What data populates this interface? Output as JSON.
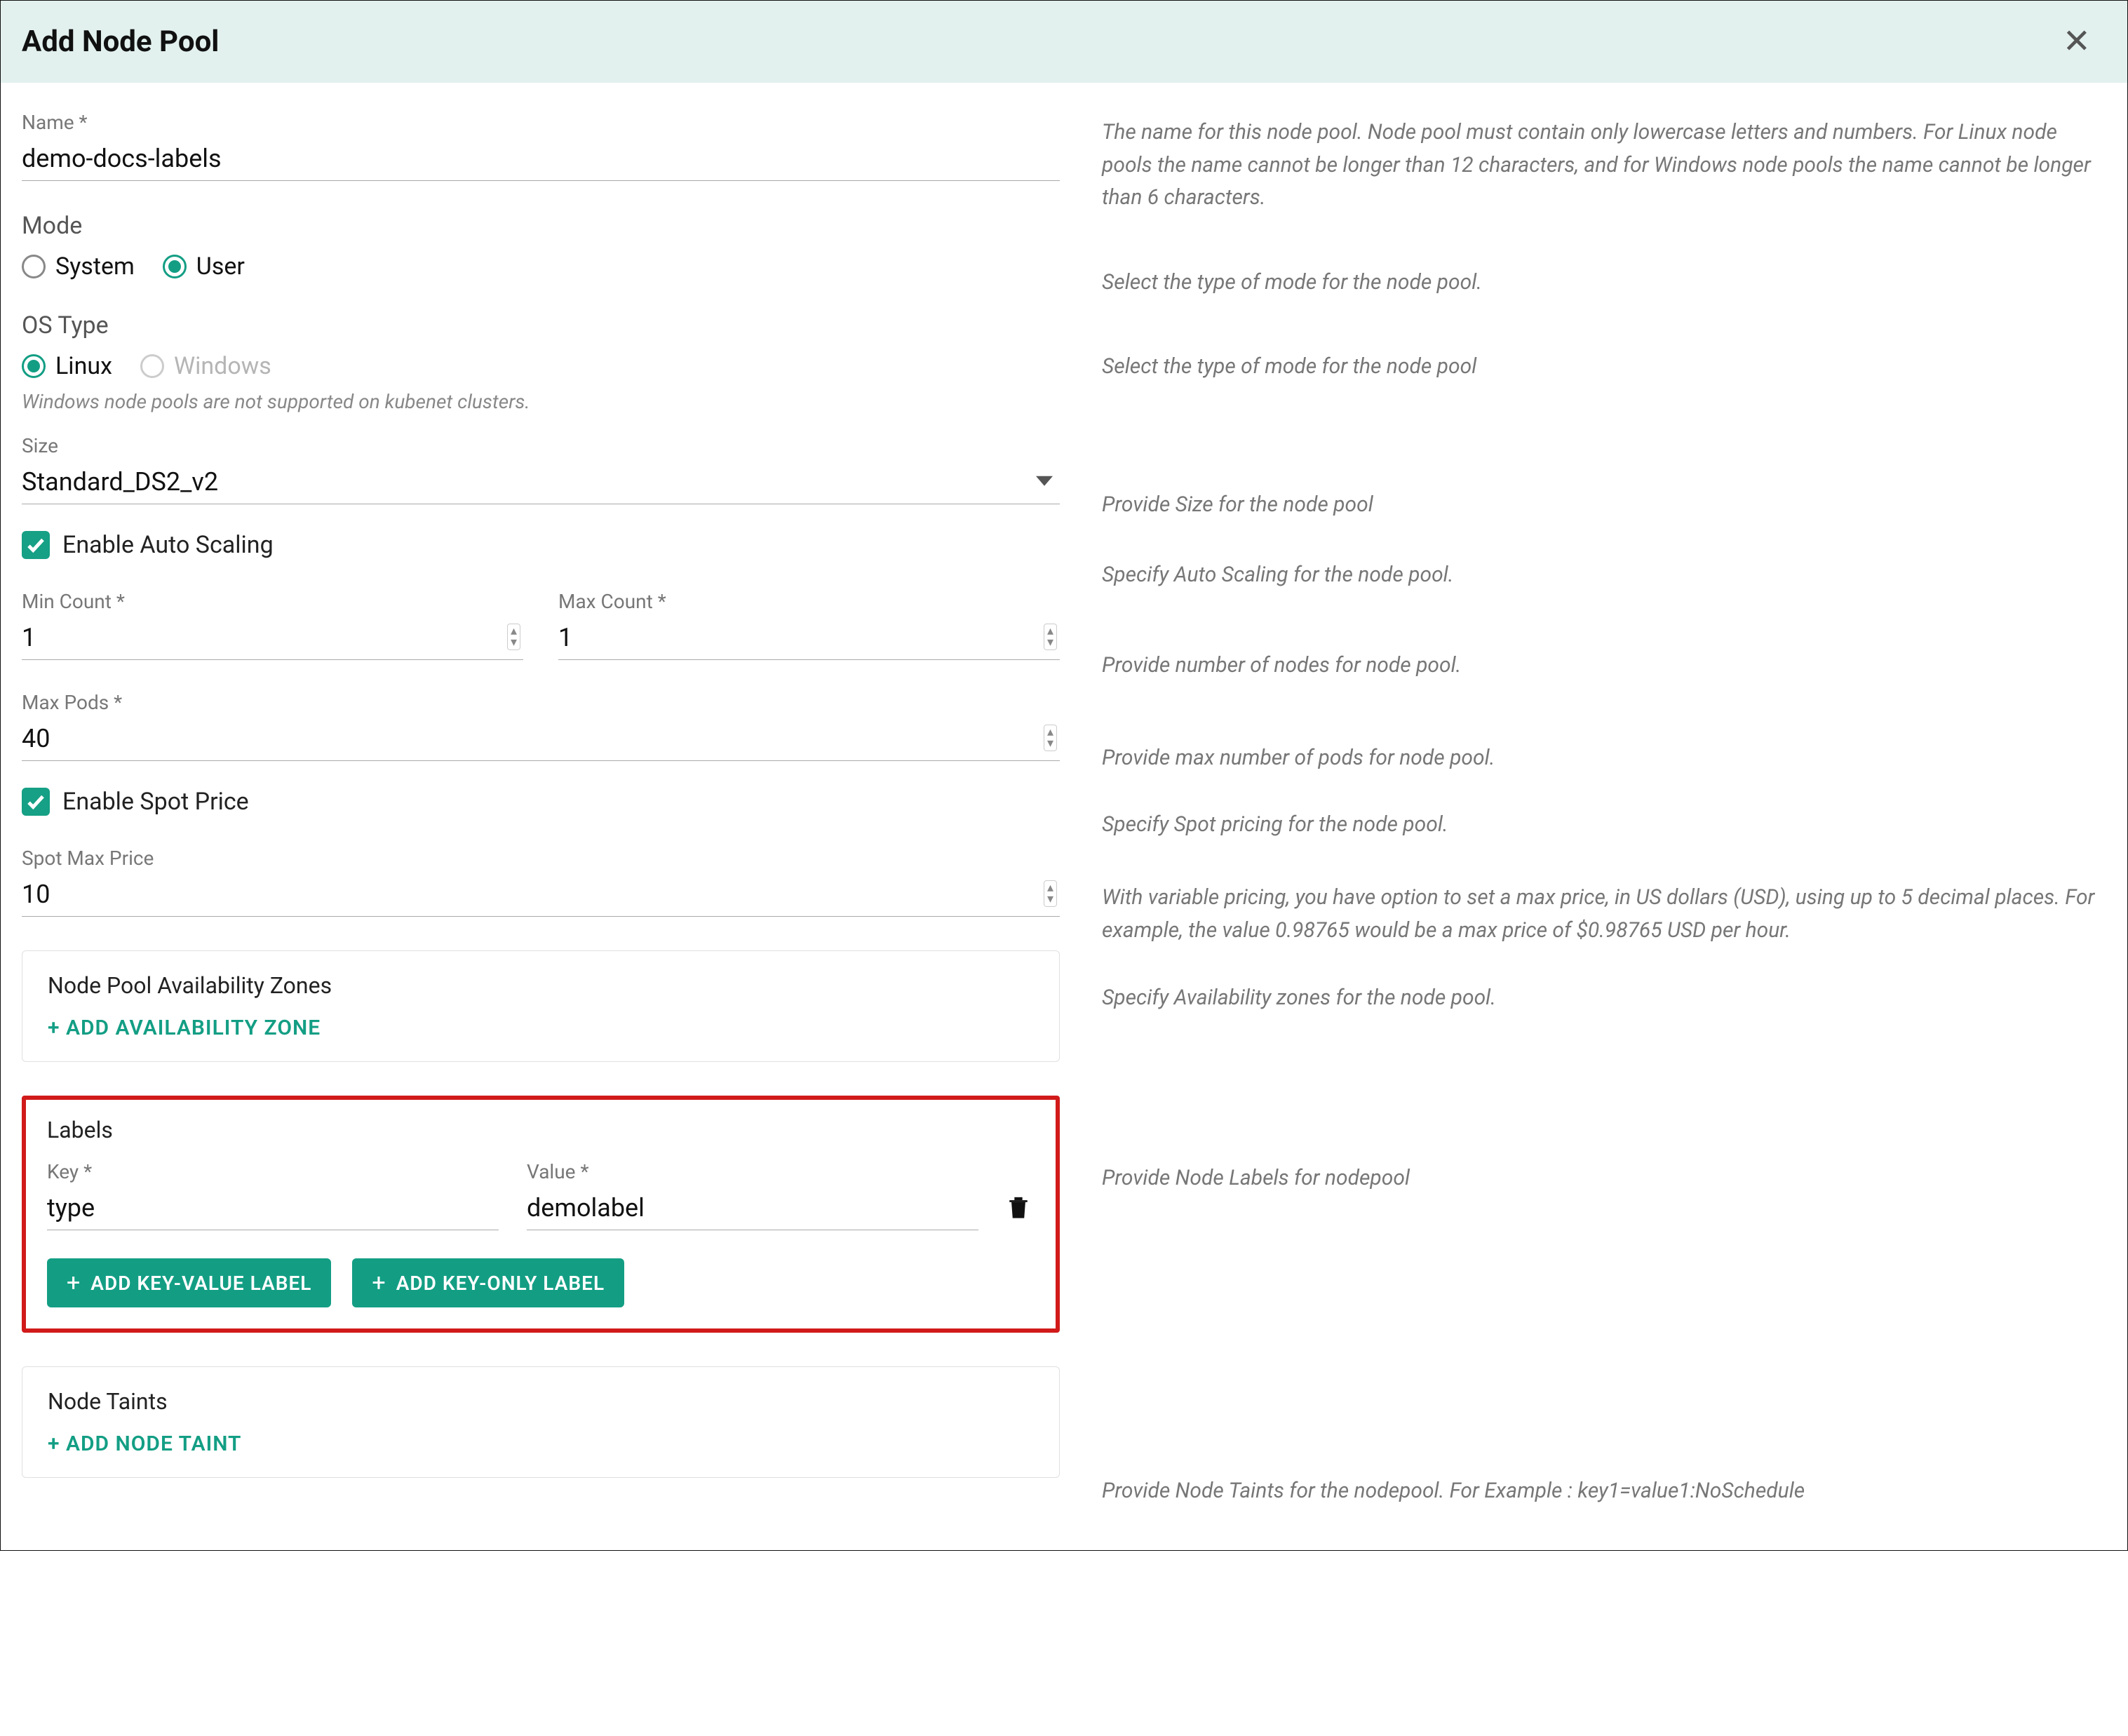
{
  "header": {
    "title": "Add Node Pool",
    "close_icon": "close-icon"
  },
  "name": {
    "label": "Name *",
    "value": "demo-docs-labels",
    "help": "The name for this node pool. Node pool must contain only lowercase letters and numbers. For Linux node pools the name cannot be longer than 12 characters, and for Windows node pools the name cannot be longer than 6 characters."
  },
  "mode": {
    "label": "Mode",
    "options": {
      "system": "System",
      "user": "User"
    },
    "selected": "user",
    "help": "Select the type of mode for the node pool."
  },
  "os": {
    "label": "OS Type",
    "options": {
      "linux": "Linux",
      "windows": "Windows"
    },
    "selected": "linux",
    "windows_disabled": true,
    "note": "Windows node pools are not supported on kubenet clusters.",
    "help": "Select the type of mode for the node pool"
  },
  "size": {
    "label": "Size",
    "value": "Standard_DS2_v2",
    "help": "Provide Size for the node pool"
  },
  "autoscale": {
    "label": "Enable Auto Scaling",
    "checked": true,
    "help": "Specify Auto Scaling for the node pool."
  },
  "min_count": {
    "label": "Min Count *",
    "value": "1"
  },
  "max_count": {
    "label": "Max Count *",
    "value": "1"
  },
  "counts_help": "Provide number of nodes for node pool.",
  "max_pods": {
    "label": "Max Pods *",
    "value": "40",
    "help": "Provide max number of pods for node pool."
  },
  "spot": {
    "label": "Enable Spot Price",
    "checked": true,
    "help": "Specify Spot pricing for the node pool."
  },
  "spot_max": {
    "label": "Spot Max Price",
    "value": "10",
    "help": "With variable pricing, you have option to set a max price, in US dollars (USD), using up to 5 decimal places. For example, the value 0.98765 would be a max price of $0.98765 USD per hour."
  },
  "zones": {
    "title": "Node Pool Availability Zones",
    "add_label": "+ ADD  AVAILABILITY ZONE",
    "help": "Specify Availability zones for the node pool."
  },
  "labels": {
    "title": "Labels",
    "key_label": "Key *",
    "value_label": "Value *",
    "rows": [
      {
        "key": "type",
        "value": "demolabel"
      }
    ],
    "btn_kv": "ADD KEY-VALUE LABEL",
    "btn_konly": "ADD KEY-ONLY LABEL",
    "help": "Provide Node Labels for nodepool"
  },
  "taints": {
    "title": "Node Taints",
    "add_label": "+ ADD  NODE TAINT",
    "help": "Provide Node Taints for the nodepool. For Example : key1=value1:NoSchedule"
  }
}
